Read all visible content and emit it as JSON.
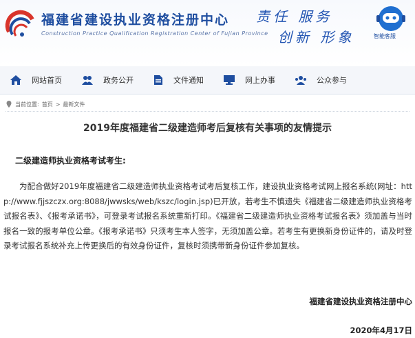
{
  "header": {
    "site_title": "福建省建设执业资格注册中心",
    "site_subtitle": "Construction Practice Qualification Registration Center of Fujian Province",
    "slogan_line1": "责任 服务",
    "slogan_line2": "创新 形象",
    "assistant_label": "智能客服"
  },
  "nav": {
    "items": [
      {
        "label": "网站首页",
        "icon": "home-icon"
      },
      {
        "label": "政务公开",
        "icon": "people-icon"
      },
      {
        "label": "文件通知",
        "icon": "document-icon"
      },
      {
        "label": "网上办事",
        "icon": "monitor-icon"
      },
      {
        "label": "公众参与",
        "icon": "group-icon"
      }
    ]
  },
  "breadcrumb": {
    "prefix": "当前位置:",
    "home": "首页",
    "separator": ">",
    "current": "最新文件"
  },
  "article": {
    "title": "2019年度福建省二级建造师考后复核有关事项的友情提示",
    "greeting": "二级建造师执业资格考试考生:",
    "body": "为配合做好2019年度福建省二级建造师执业资格考试考后复核工作，建设执业资格考试网上报名系统(网址：http://www.fjjszczx.org:8088/jwwsks/web/kszc/login.jsp)已开放，若考生不慎遗失《福建省二级建造师执业资格考试报名表》、《报考承诺书》，可登录考试报名系统重新打印。《福建省二级建造师执业资格考试报名表》须加盖与当时报名一致的报考单位公章。《报考承诺书》只须考生本人签字，无须加盖公章。若考生有更换新身份证件的，请及时登录考试报名系统补充上传更换后的有效身份证件，复核时须携带新身份证件参加复核。",
    "signature_org": "福建省建设执业资格注册中心",
    "signature_date": "2020年4月17日"
  },
  "colors": {
    "brand_blue": "#1f4ea0",
    "logo_red": "#d9342b"
  }
}
